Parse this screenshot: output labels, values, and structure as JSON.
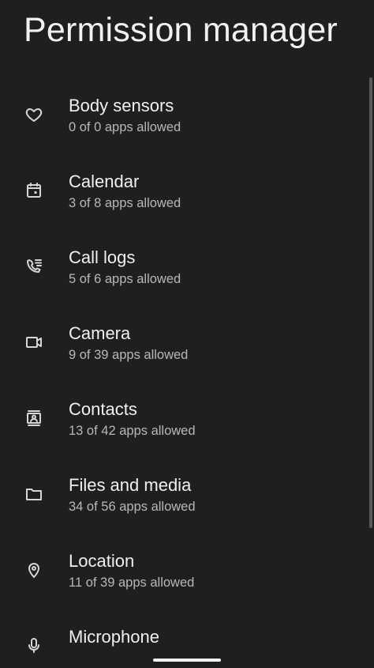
{
  "header": {
    "title": "Permission manager"
  },
  "permissions": [
    {
      "label": "Body sensors",
      "status": "0 of 0 apps allowed",
      "icon": "heart-icon"
    },
    {
      "label": "Calendar",
      "status": "3 of 8 apps allowed",
      "icon": "calendar-icon"
    },
    {
      "label": "Call logs",
      "status": "5 of 6 apps allowed",
      "icon": "call-log-icon"
    },
    {
      "label": "Camera",
      "status": "9 of 39 apps allowed",
      "icon": "camera-icon"
    },
    {
      "label": "Contacts",
      "status": "13 of 42 apps allowed",
      "icon": "contacts-icon"
    },
    {
      "label": "Files and media",
      "status": "34 of 56 apps allowed",
      "icon": "folder-icon"
    },
    {
      "label": "Location",
      "status": "11 of 39 apps allowed",
      "icon": "location-pin-icon"
    },
    {
      "label": "Microphone",
      "status": "",
      "icon": "microphone-icon"
    }
  ],
  "colors": {
    "background": "#1f1f1f",
    "primary_text": "#f0f0f0",
    "secondary_text": "#b8b8b8",
    "icon": "#d6d6d6"
  }
}
